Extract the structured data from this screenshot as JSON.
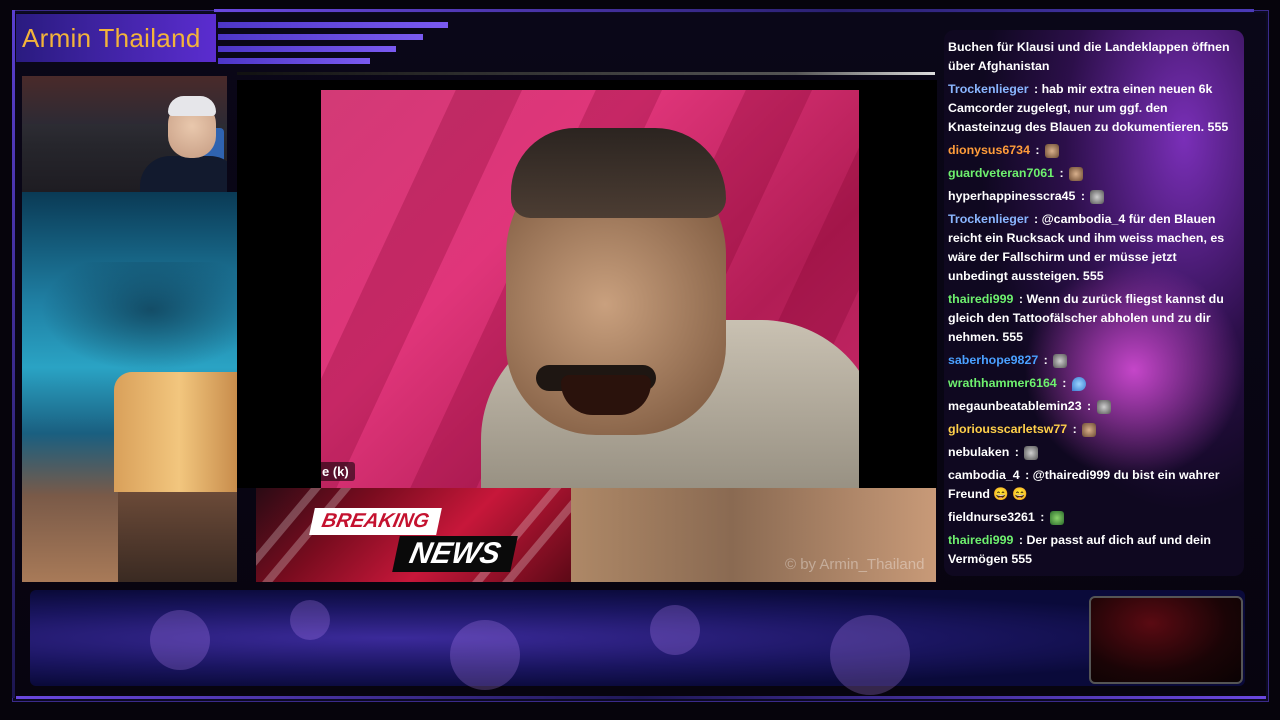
{
  "header": {
    "title": "Armin Thailand"
  },
  "video": {
    "caption": "e (k)"
  },
  "news_banner": {
    "breaking": "BREAKING",
    "news": "NEWS"
  },
  "watermark": "© by Armin_Thailand",
  "chat": {
    "messages": [
      {
        "user": "",
        "user_color": "#ffffff",
        "text": "Buchen für Klausi und die Landeklappen öffnen über Afghanistan"
      },
      {
        "user": "Trockenlieger",
        "user_color": "#8ab6ff",
        "text": "hab mir extra einen neuen 6k Camcorder zugelegt, nur um ggf. den Knasteinzug des Blauen zu dokumentieren. 555"
      },
      {
        "user": "dionysus6734",
        "user_color": "#ff9c3a",
        "text": "",
        "emote": "face"
      },
      {
        "user": "guardveteran7061",
        "user_color": "#6ef06e",
        "text": "",
        "emote": "face"
      },
      {
        "user": "hyperhappinesscra45",
        "user_color": "#ffffff",
        "text": "",
        "emote": "gray"
      },
      {
        "user": "Trockenlieger",
        "user_color": "#8ab6ff",
        "text": "@cambodia_4 für den Blauen reicht ein Rucksack und ihm weiss machen, es wäre der Fallschirm und er müsse jetzt unbedingt aussteigen. 555"
      },
      {
        "user": "thairedi999",
        "user_color": "#6ef06e",
        "text": "Wenn du zurück fliegst kannst du gleich den Tattoofälscher abholen und zu dir nehmen. 555"
      },
      {
        "user": "saberhope9827",
        "user_color": "#4aa0ff",
        "text": "",
        "emote": "gray"
      },
      {
        "user": "wrathhammer6164",
        "user_color": "#6ef06e",
        "text": "",
        "emote": "blue"
      },
      {
        "user": "megaunbeatablemin23",
        "user_color": "#ffffff",
        "text": "",
        "emote": "gray"
      },
      {
        "user": "gloriousscarletsw77",
        "user_color": "#ffd04a",
        "text": "",
        "emote": "face"
      },
      {
        "user": "nebulaken",
        "user_color": "#ffffff",
        "text": "",
        "emote": "gray"
      },
      {
        "user": "cambodia_4",
        "user_color": "#ffffff",
        "text": "@thairedi999 du bist ein wahrer Freund 😄 😄"
      },
      {
        "user": "fieldnurse3261",
        "user_color": "#ffffff",
        "text": "",
        "emote": "green"
      },
      {
        "user": "thairedi999",
        "user_color": "#6ef06e",
        "text": "Der passt auf dich auf und dein Vermögen 555"
      }
    ]
  }
}
